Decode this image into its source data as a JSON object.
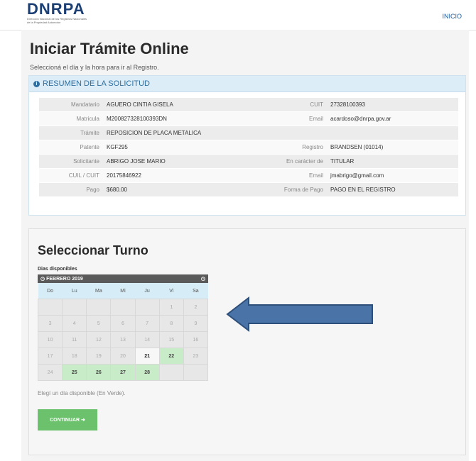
{
  "header": {
    "logo": "DNRPA",
    "logo_subtitle": "Dirección Nacional de los Registros Nacionales de la Propiedad Automotor",
    "nav_inicio": "INICIO"
  },
  "page": {
    "title": "Iniciar Trámite Online",
    "subtitle": "Seleccioná el día y la hora para ir al Registro."
  },
  "summary": {
    "heading": "RESUMEN DE LA SOLICITUD",
    "rows": [
      {
        "l1": "Mandatario",
        "v1": "AGUERO CINTIA GISELA",
        "l2": "CUIT",
        "v2": "27328100393"
      },
      {
        "l1": "Matricula",
        "v1": "M200827328100393DN",
        "l2": "Email",
        "v2": "acardoso@dnrpa.gov.ar"
      },
      {
        "l1": "Trámite",
        "v1": "REPOSICION DE PLACA METALICA",
        "l2": "",
        "v2": ""
      },
      {
        "l1": "Patente",
        "v1": "KGF295",
        "l2": "Registro",
        "v2": "BRANDSEN (01014)"
      },
      {
        "l1": "Solicitante",
        "v1": "ABRIGO JOSE MARIO",
        "l2": "En carácter de",
        "v2": "TITULAR"
      },
      {
        "l1": "CUIL / CUIT",
        "v1": "20175846922",
        "l2": "Email",
        "v2": "jmabrigo@gmail.com"
      },
      {
        "l1": "Pago",
        "v1": "$680.00",
        "l2": "Forma de Pago",
        "v2": "PAGO EN EL REGISTRO"
      }
    ]
  },
  "turno": {
    "title": "Seleccionar Turno",
    "dias_label": "Dias disponibles",
    "month": "FEBRERO 2019",
    "weekdays": [
      "Do",
      "Lu",
      "Ma",
      "Mi",
      "Ju",
      "Vi",
      "Sa"
    ],
    "weeks": [
      [
        {
          "d": ""
        },
        {
          "d": ""
        },
        {
          "d": ""
        },
        {
          "d": ""
        },
        {
          "d": ""
        },
        {
          "d": "1"
        },
        {
          "d": "2"
        }
      ],
      [
        {
          "d": "3"
        },
        {
          "d": "4"
        },
        {
          "d": "5"
        },
        {
          "d": "6"
        },
        {
          "d": "7"
        },
        {
          "d": "8"
        },
        {
          "d": "9"
        }
      ],
      [
        {
          "d": "10"
        },
        {
          "d": "11"
        },
        {
          "d": "12"
        },
        {
          "d": "13"
        },
        {
          "d": "14"
        },
        {
          "d": "15"
        },
        {
          "d": "16"
        }
      ],
      [
        {
          "d": "17"
        },
        {
          "d": "18"
        },
        {
          "d": "19"
        },
        {
          "d": "20"
        },
        {
          "d": "21",
          "s": "today"
        },
        {
          "d": "22",
          "s": "avail"
        },
        {
          "d": "23"
        }
      ],
      [
        {
          "d": "24"
        },
        {
          "d": "25",
          "s": "avail"
        },
        {
          "d": "26",
          "s": "avail"
        },
        {
          "d": "27",
          "s": "avail"
        },
        {
          "d": "28",
          "s": "avail"
        },
        {
          "d": ""
        },
        {
          "d": ""
        }
      ]
    ],
    "hint": "Elegí un día disponible (En Verde).",
    "button": "CONTINUAR",
    "button_icon": "arrow-right-icon"
  },
  "colors": {
    "accent_blue": "#2f6fa0",
    "available_green": "#c8ebc8",
    "button_green": "#6cc26c",
    "arrow_blue": "#4a74a8"
  }
}
